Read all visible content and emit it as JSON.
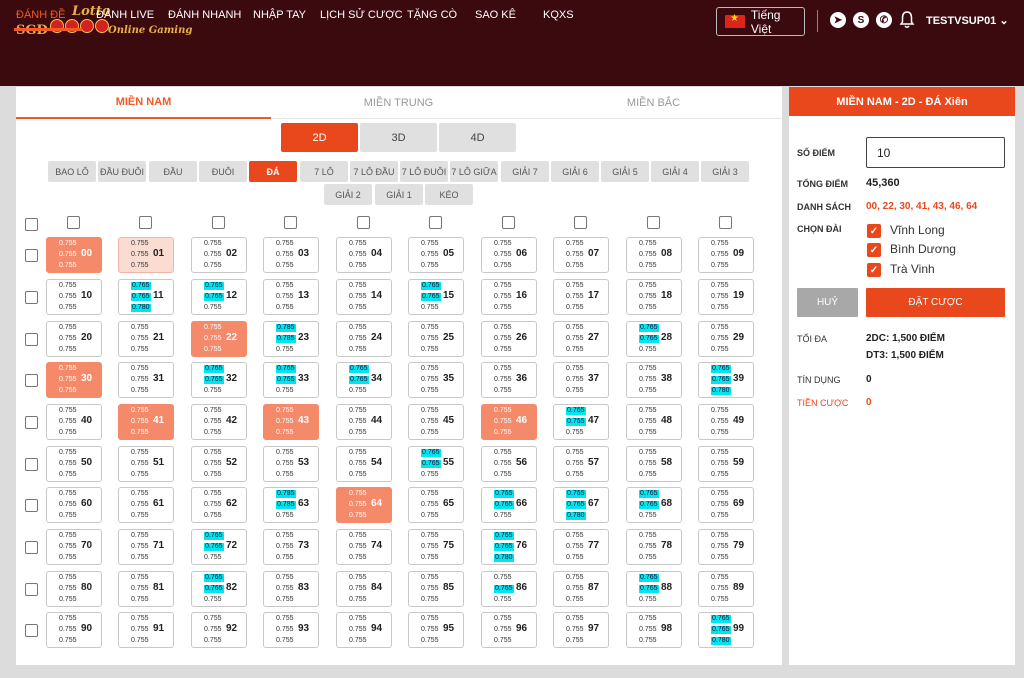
{
  "header": {
    "logo": {
      "top": "Lotto",
      "sgd": "SGD",
      "online": "Online Gaming"
    },
    "language": "Tiếng Việt",
    "username": "TESTVSUP01",
    "colors": {
      "background": "#3a0a0f",
      "accent": "#f15a24"
    }
  },
  "nav": [
    "ĐÁNH ĐỀ",
    "ĐÁNH LIVE",
    "ĐÁNH NHANH",
    "NHẬP TAY",
    "LỊCH SỬ CƯỢC",
    "TẶNG CÒ",
    "SAO KÊ",
    "KQXS"
  ],
  "regions": [
    "MIỀN NAM",
    "MIỀN TRUNG",
    "MIỀN BẮC"
  ],
  "modes": [
    "2D",
    "3D",
    "4D"
  ],
  "bet_types_row1": [
    "BAO LÔ",
    "ĐẦU ĐUÔI",
    "ĐẦU",
    "ĐUÔI",
    "ĐÁ",
    "7 LÔ",
    "7 LÔ ĐẦU",
    "7 LÔ ĐUÔI",
    "7 LÔ GIỮA",
    "GIẢI 7",
    "GIẢI 6",
    "GIẢI 5",
    "GIẢI 4",
    "GIẢI 3"
  ],
  "bet_types_row2": [
    "GIẢI 2",
    "GIẢI 1",
    "KÉO"
  ],
  "grid": {
    "odds_normal": "0.755",
    "odds_boost": "0.765",
    "odds_special": "0.780",
    "odds_alt": "0.785",
    "selected": [
      "00",
      "22",
      "30",
      "41",
      "43",
      "46",
      "64"
    ],
    "light_selected": [
      "01"
    ]
  },
  "side": {
    "title": "MIỀN NAM - 2D - ĐÁ Xiên",
    "score_label": "SỐ ĐIỂM",
    "score_value": "10",
    "total_label": "TỔNG ĐIỂM",
    "total_value": "45,360",
    "list_label": "DANH SÁCH",
    "list_value": "00, 22, 30, 41, 43, 46, 64",
    "station_label": "CHỌN ĐÀI",
    "stations": [
      "Vĩnh Long",
      "Bình Dương",
      "Trà Vinh"
    ],
    "cancel_label": "HUỶ",
    "bet_label": "ĐẶT CƯỢC",
    "max_label": "TỐI ĐA",
    "max_2dc": "2DC: 1,500 ĐIỂM",
    "max_dt3": "DT3: 1,500 ĐIỂM",
    "credit_label": "TÍN DỤNG",
    "credit_value": "0",
    "bet_money_label": "TIỀN CƯỢC",
    "bet_money_value": "0"
  }
}
